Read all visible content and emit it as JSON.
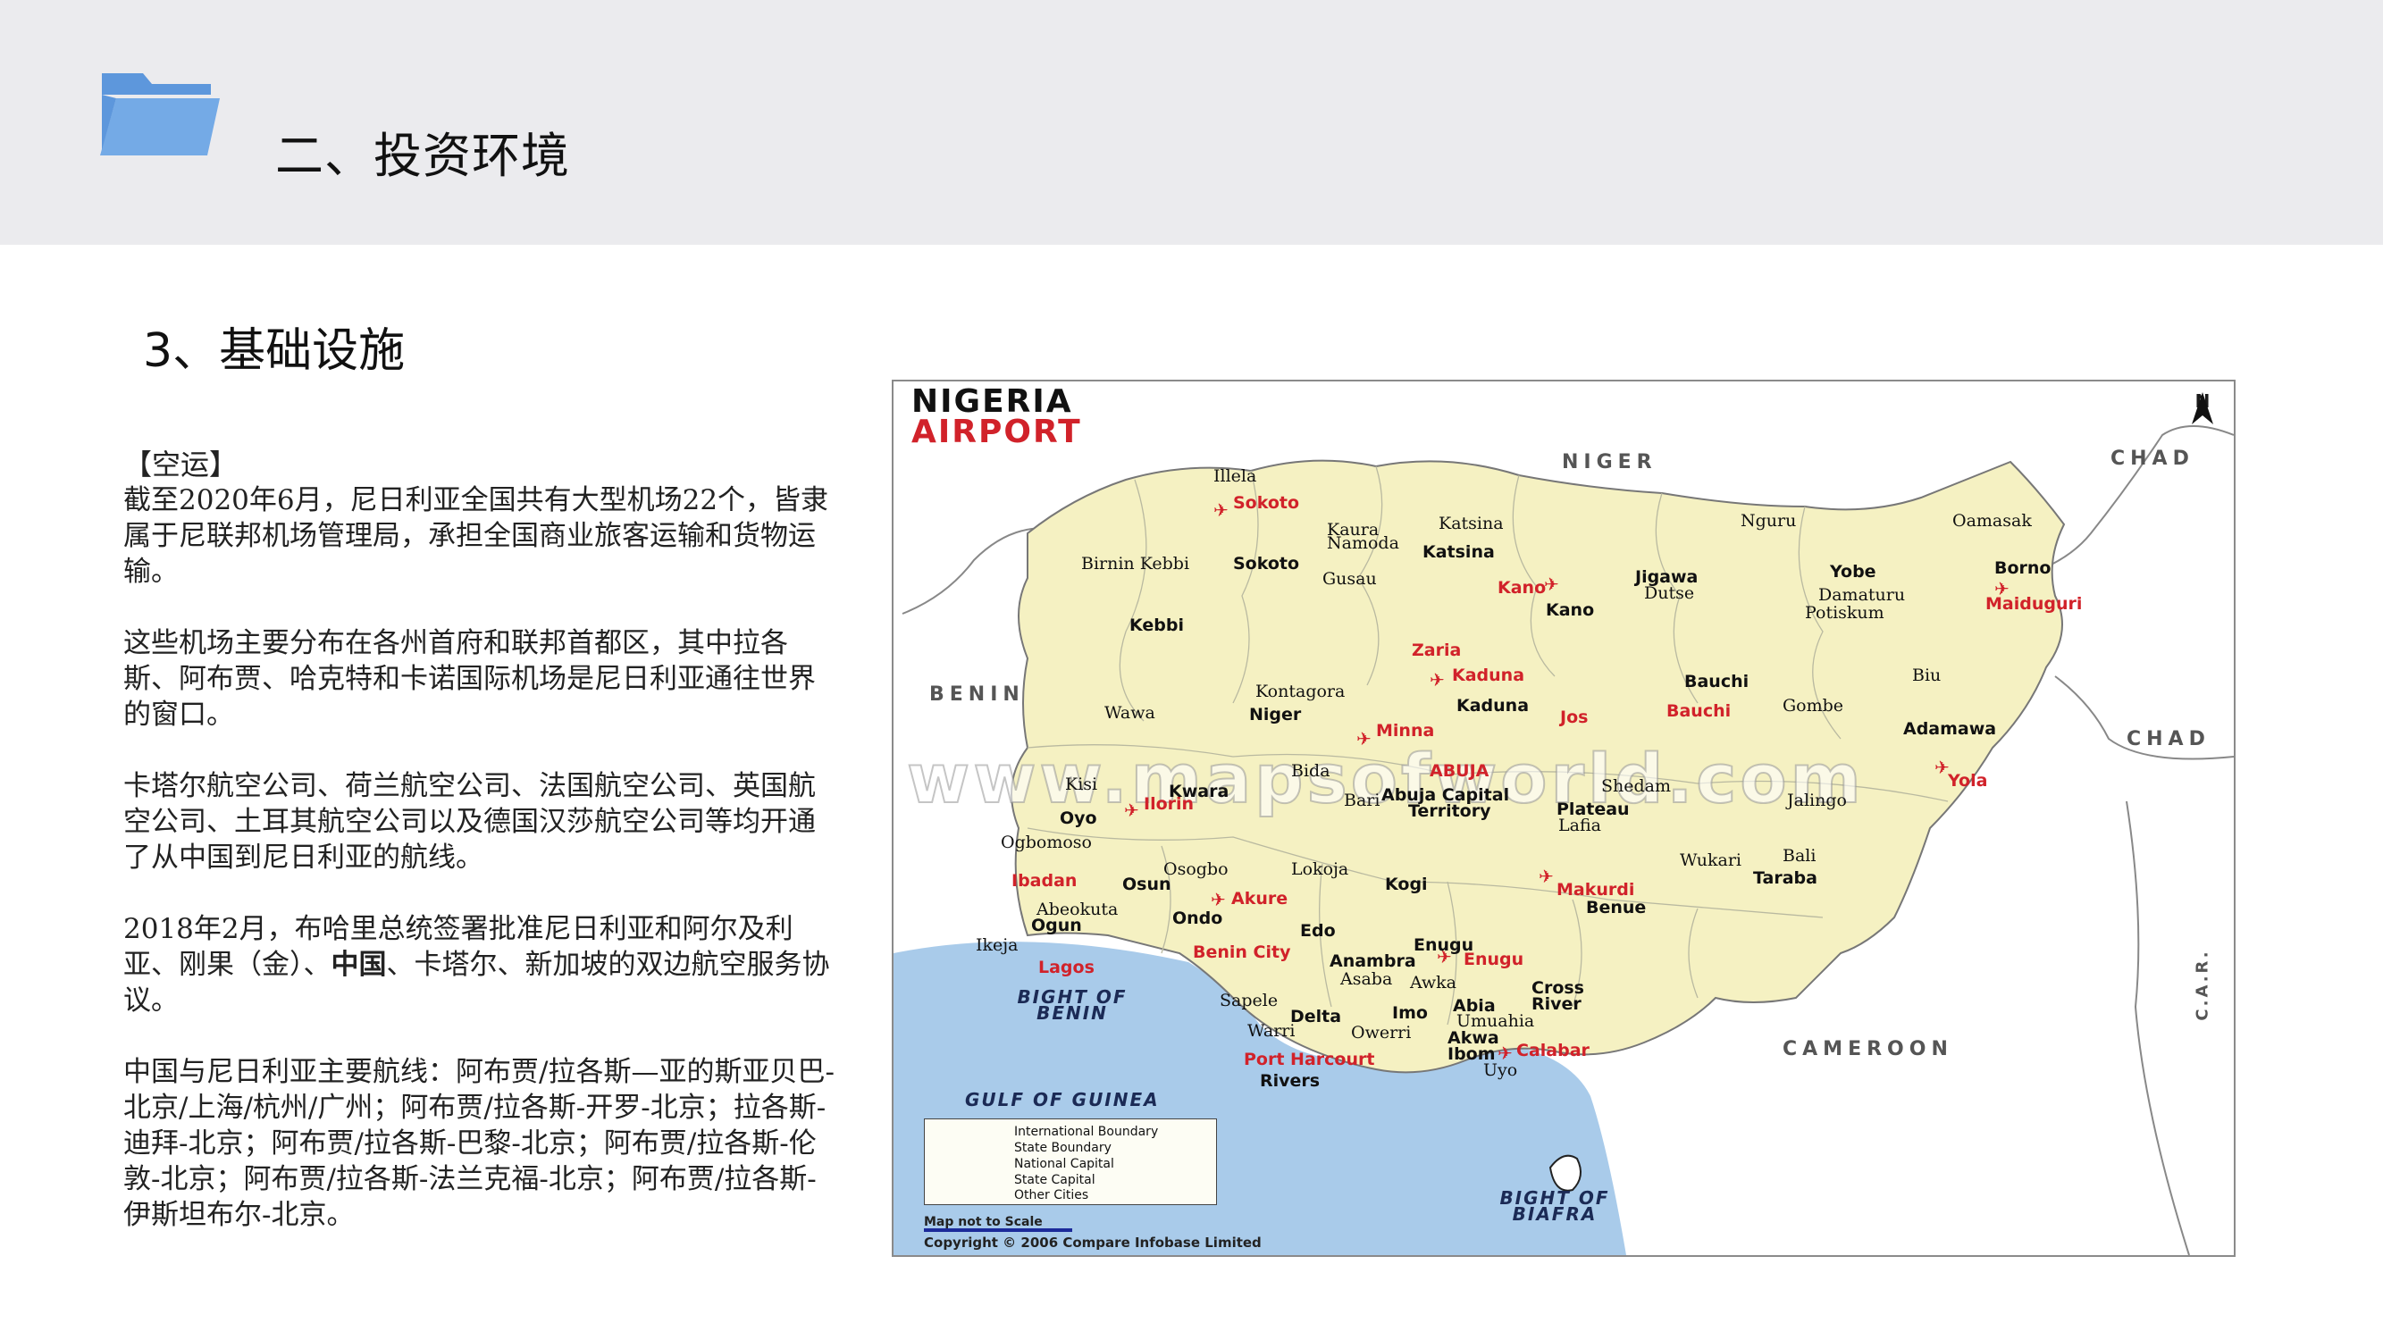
{
  "header": {
    "title": "二、投资环境",
    "icon": "folder-icon",
    "icon_color": "#6da3e0",
    "background": "#ebebee"
  },
  "section": {
    "subtitle": "3、基础设施"
  },
  "content": {
    "heading": "【空运】",
    "paragraphs": [
      "截至2020年6月，尼日利亚全国共有大型机场22个，皆隶属于尼联邦机场管理局，承担全国商业旅客运输和货物运输。",
      "这些机场主要分布在各州首府和联邦首都区，其中拉各斯、阿布贾、哈克特和卡诺国际机场是尼日利亚通往世界的窗口。",
      "卡塔尔航空公司、荷兰航空公司、法国航空公司、英国航空公司、土耳其航空公司以及德国汉莎航空公司等均开通了从中国到尼日利亚的航线。"
    ],
    "p4": {
      "before": "2018年2月，布哈里总统签署批准尼日利亚和阿尔及利亚、刚果（金）、",
      "bold": "中国",
      "after": "、卡塔尔、新加坡的双边航空服务协议。"
    },
    "p5": "中国与尼日利亚主要航线：阿布贾/拉各斯—亚的斯亚贝巴-北京/上海/杭州/广州；阿布贾/拉各斯-开罗-北京；拉各斯-迪拜-北京；阿布贾/拉各斯-巴黎-北京；阿布贾/拉各斯-伦敦-北京；阿布贾/拉各斯-法兰克福-北京；阿布贾/拉各斯-伊斯坦布尔-北京。"
  },
  "map": {
    "title_line1": "NIGERIA",
    "title_line2": "AIRPORT",
    "north": "N",
    "watermark": "www.mapsofworld.com",
    "countries": {
      "niger": "NIGER",
      "chad": "CHAD",
      "chad2": "CHAD",
      "benin": "BENIN",
      "cameroon": "CAMEROON",
      "car": "C.A.R."
    },
    "seas": {
      "bight_benin": "BIGHT OF BENIN",
      "gulf_guinea": "GULF OF GUINEA",
      "bight_biafra": "BIGHT OF BIAFRA"
    },
    "airports": {
      "sokoto": "Sokoto",
      "kano": "Kano",
      "zaria": "Zaria",
      "kaduna": "Kaduna",
      "jos": "Jos",
      "minna": "Minna",
      "abuja": "ABUJA",
      "ilorin": "Ilorin",
      "ibadan": "Ibadan",
      "lagos": "Lagos",
      "akure": "Akure",
      "benin_city": "Benin City",
      "enugu": "Enugu",
      "port_harcourt": "Port Harcourt",
      "calabar": "Calabar",
      "makurdi": "Makurdi",
      "bauchi": "Bauchi",
      "yola": "Yola",
      "maiduguri": "Maiduguri"
    },
    "states": {
      "sokoto": "Sokoto",
      "kebbi": "Kebbi",
      "katsina": "Katsina",
      "kano": "Kano",
      "jigawa": "Jigawa",
      "yobe": "Yobe",
      "borno": "Borno",
      "kaduna": "Kaduna",
      "bauchi": "Bauchi",
      "gombe": "Gombe",
      "niger": "Niger",
      "adamawa": "Adamawa",
      "kwara": "Kwara",
      "fct1": "Abuja Capital",
      "fct2": "Territory",
      "plateau": "Plateau",
      "oyo": "Oyo",
      "osun": "Osun",
      "ogun": "Ogun",
      "ondo": "Ondo",
      "edo": "Edo",
      "kogi": "Kogi",
      "benue": "Benue",
      "taraba": "Taraba",
      "anambra": "Anambra",
      "enugu": "Enugu",
      "delta": "Delta",
      "imo": "Imo",
      "abia": "Abia",
      "cross_river1": "Cross",
      "cross_river2": "River",
      "akwa1": "Akwa",
      "akwa2": "Ibom",
      "rivers": "Rivers"
    },
    "cities": {
      "illela": "Illela",
      "kaura": "Kaura",
      "namoda": "Namoda",
      "gusau": "Gusau",
      "katsina": "Katsina",
      "nguru": "Nguru",
      "oamasak": "Oamasak",
      "birnin_kebbi": "Birnin Kebbi",
      "dutse": "Dutse",
      "damaturu": "Damaturu",
      "potiskum": "Potiskum",
      "biu": "Biu",
      "kontagora": "Kontagora",
      "wawa": "Wawa",
      "bida": "Bida",
      "bari": "Bari",
      "shedam": "Shedam",
      "lafia": "Lafia",
      "jalingo": "Jalingo",
      "kisi": "Kisi",
      "ogbomoso": "Ogbomoso",
      "osogbo": "Osogbo",
      "lokoja": "Lokoja",
      "wukari": "Wukari",
      "bali": "Bali",
      "abeokuta": "Abeokuta",
      "ikeja": "Ikeja",
      "asaba": "Asaba",
      "awka": "Awka",
      "sapele": "Sapele",
      "warri": "Warri",
      "owerri": "Owerri",
      "umuahia": "Umuahia",
      "uyo": "Uyo"
    },
    "legend": {
      "items": [
        "International Boundary",
        "State Boundary",
        "National Capital",
        "State Capital",
        "Other Cities"
      ]
    },
    "scale_note": "Map not to Scale",
    "copyright": "Copyright © 2006 Compare Infobase Limited"
  }
}
